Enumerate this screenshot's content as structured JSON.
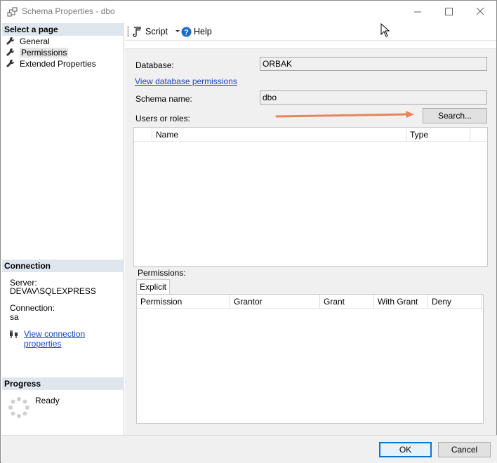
{
  "window": {
    "title": "Schema Properties - dbo",
    "minimize_symbol": "—",
    "maximize_symbol": "☐",
    "close_symbol": "✕"
  },
  "left": {
    "select_page_header": "Select a page",
    "pages": [
      {
        "label": "General",
        "icon": "wrench-icon"
      },
      {
        "label": "Permissions",
        "icon": "wrench-icon"
      },
      {
        "label": "Extended Properties",
        "icon": "wrench-icon"
      }
    ],
    "connection_header": "Connection",
    "server_label": "Server:",
    "server_value": "DEVAV\\SQLEXPRESS",
    "connection_label": "Connection:",
    "connection_value": "sa",
    "view_connection_link": "View connection properties",
    "progress_header": "Progress",
    "progress_status": "Ready"
  },
  "toolbar": {
    "script_label": "Script",
    "help_label": "Help"
  },
  "form": {
    "database_label": "Database:",
    "database_value": "ORBAK",
    "view_db_permissions_link": "View database permissions",
    "schema_name_label": "Schema name:",
    "schema_name_value": "dbo",
    "users_roles_label": "Users or roles:",
    "search_button": "Search...",
    "users_columns": [
      "Name",
      "Type"
    ],
    "permissions_label": "Permissions:",
    "explicit_tab": "Explicit",
    "perm_columns": [
      "Permission",
      "Grantor",
      "Grant",
      "With Grant",
      "Deny"
    ]
  },
  "footer": {
    "ok_label": "OK",
    "cancel_label": "Cancel"
  },
  "colors": {
    "section_header_bg": "#dfe6ee",
    "link": "#1a44c8",
    "annotation_arrow": "#e8845a",
    "ok_border": "#0078d7"
  }
}
